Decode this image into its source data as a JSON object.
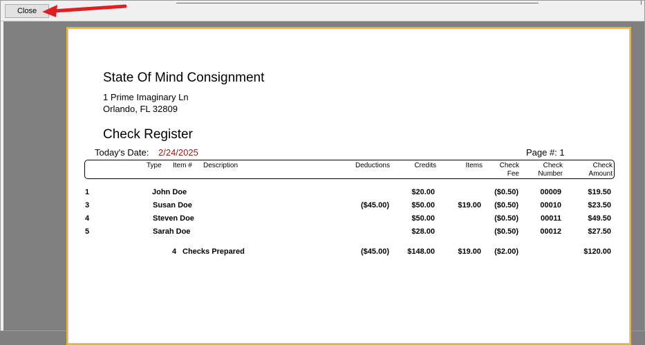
{
  "toolbar": {
    "close_label": "Close"
  },
  "report": {
    "company": "State Of Mind Consignment",
    "address_line1": "1 Prime Imaginary Ln",
    "address_line2": "Orlando, FL  32809",
    "title": "Check Register",
    "date_label": "Today's Date:",
    "date_value": "2/24/2025",
    "page_label": "Page #: 1"
  },
  "columns": {
    "type": "Type",
    "item": "Item #",
    "description": "Description",
    "deductions": "Deductions",
    "credits": "Credits",
    "items": "Items",
    "fee_1": "Check",
    "fee_2": "Fee",
    "number_1": "Check",
    "number_2": "Number",
    "amount_1": "Check",
    "amount_2": "Amount"
  },
  "rows": [
    {
      "id": "1",
      "name": "John Doe",
      "deductions": "",
      "credits": "$20.00",
      "items": "",
      "fee": "($0.50)",
      "number": "00009",
      "amount": "$19.50"
    },
    {
      "id": "3",
      "name": "Susan Doe",
      "deductions": "($45.00)",
      "credits": "$50.00",
      "items": "$19.00",
      "fee": "($0.50)",
      "number": "00010",
      "amount": "$23.50"
    },
    {
      "id": "4",
      "name": "Steven Doe",
      "deductions": "",
      "credits": "$50.00",
      "items": "",
      "fee": "($0.50)",
      "number": "00011",
      "amount": "$49.50"
    },
    {
      "id": "5",
      "name": "Sarah Doe",
      "deductions": "",
      "credits": "$28.00",
      "items": "",
      "fee": "($0.50)",
      "number": "00012",
      "amount": "$27.50"
    }
  ],
  "totals": {
    "count": "4",
    "label": "Checks Prepared",
    "deductions": "($45.00)",
    "credits": "$148.00",
    "items": "$19.00",
    "fee": "($2.00)",
    "amount": "$120.00"
  },
  "colors": {
    "page_border": "#f0b429",
    "date": "#8b1a1a",
    "arrow": "#e02020"
  }
}
